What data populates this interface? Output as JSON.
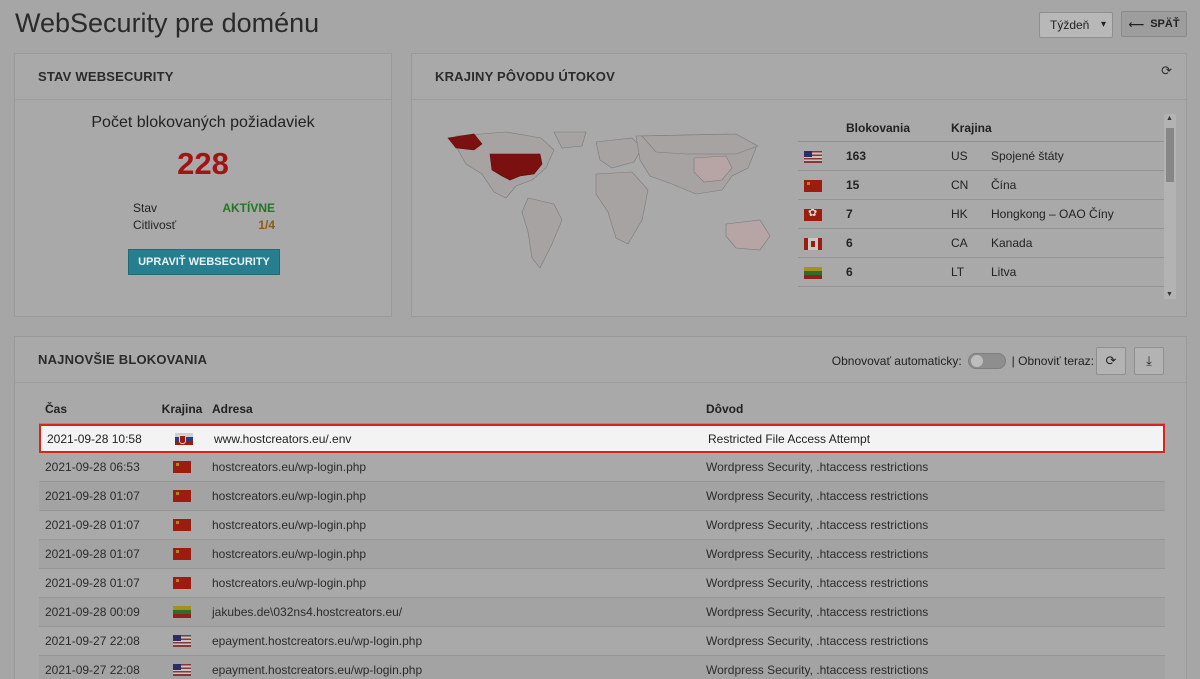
{
  "page": {
    "title": "WebSecurity pre doménu"
  },
  "toolbar": {
    "period": "Týždeň",
    "back_label": "SPÄŤ"
  },
  "status": {
    "header": "STAV WEBSECURITY",
    "blocked_label": "Počet blokovaných požiadaviek",
    "blocked_count": "228",
    "state_label": "Stav",
    "state_value": "AKTÍVNE",
    "sensitivity_label": "Citlivosť",
    "sensitivity_value": "1/4",
    "edit_button": "UPRAVIŤ WEBSECURITY"
  },
  "countries": {
    "header": "KRAJINY PÔVODU ÚTOKOV",
    "col_blocks": "Blokovania",
    "col_country": "Krajina",
    "rows": [
      {
        "flag": "us",
        "count": "163",
        "code": "US",
        "name": "Spojené štáty"
      },
      {
        "flag": "cn",
        "count": "15",
        "code": "CN",
        "name": "Čína"
      },
      {
        "flag": "hk",
        "count": "7",
        "code": "HK",
        "name": "Hongkong – OAO Číny"
      },
      {
        "flag": "ca",
        "count": "6",
        "code": "CA",
        "name": "Kanada"
      },
      {
        "flag": "lt",
        "count": "6",
        "code": "LT",
        "name": "Litva"
      }
    ]
  },
  "latest": {
    "header": "NAJNOVŠIE BLOKOVANIA",
    "auto_refresh_label": "Obnovovať automaticky:",
    "refresh_now_label": "| Obnoviť teraz:",
    "columns": {
      "time": "Čas",
      "country": "Krajina",
      "address": "Adresa",
      "reason": "Dôvod"
    },
    "rows": [
      {
        "time": "2021-09-28 10:58",
        "flag": "sk",
        "address": "www.hostcreators.eu/.env",
        "reason": "Restricted File Access Attempt"
      },
      {
        "time": "2021-09-28 06:53",
        "flag": "cn",
        "address": "hostcreators.eu/wp-login.php",
        "reason": "Wordpress Security, .htaccess restrictions"
      },
      {
        "time": "2021-09-28 01:07",
        "flag": "cn",
        "address": "hostcreators.eu/wp-login.php",
        "reason": "Wordpress Security, .htaccess restrictions"
      },
      {
        "time": "2021-09-28 01:07",
        "flag": "cn",
        "address": "hostcreators.eu/wp-login.php",
        "reason": "Wordpress Security, .htaccess restrictions"
      },
      {
        "time": "2021-09-28 01:07",
        "flag": "cn",
        "address": "hostcreators.eu/wp-login.php",
        "reason": "Wordpress Security, .htaccess restrictions"
      },
      {
        "time": "2021-09-28 01:07",
        "flag": "cn",
        "address": "hostcreators.eu/wp-login.php",
        "reason": "Wordpress Security, .htaccess restrictions"
      },
      {
        "time": "2021-09-28 00:09",
        "flag": "lt",
        "address": "jakubes.de\\032ns4.hostcreators.eu/",
        "reason": "Wordpress Security, .htaccess restrictions"
      },
      {
        "time": "2021-09-27 22:08",
        "flag": "us",
        "address": "epayment.hostcreators.eu/wp-login.php",
        "reason": "Wordpress Security, .htaccess restrictions"
      },
      {
        "time": "2021-09-27 22:08",
        "flag": "us",
        "address": "epayment.hostcreators.eu/wp-login.php",
        "reason": "Wordpress Security, .htaccess restrictions"
      }
    ]
  },
  "colors": {
    "count_red": "#a31313",
    "active_green": "#1f7a1f",
    "edit_button": "#277e8e",
    "highlight_border": "#d9241a"
  }
}
